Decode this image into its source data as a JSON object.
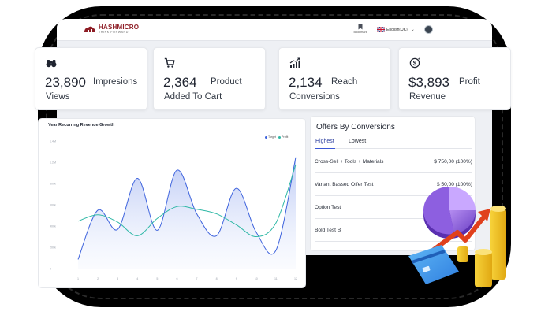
{
  "header": {
    "logo_name": "HASHMICRO",
    "logo_tagline": "THINK FORWARD",
    "bookmark_label": "Bookmark",
    "language_label": "English(UK)"
  },
  "stats": [
    {
      "icon": "binoculars-icon",
      "value": "23,890",
      "unit": "Impresions",
      "sub": "Views"
    },
    {
      "icon": "cart-icon",
      "value": "2,364",
      "unit": "Product",
      "sub": "Added To Cart"
    },
    {
      "icon": "bar-chart-icon",
      "value": "2,134",
      "unit": "Reach",
      "sub": "Conversions"
    },
    {
      "icon": "revenue-icon",
      "value": "$3,893",
      "unit": "Profit",
      "sub": "Revenue"
    }
  ],
  "chart_data": {
    "type": "area",
    "title": "Year Recurring Revenue Growth",
    "x": [
      "1",
      "2",
      "3",
      "4",
      "5",
      "6",
      "7",
      "8",
      "9",
      "10",
      "11",
      "12"
    ],
    "y_ticks": [
      "0",
      "200k",
      "400k",
      "600k",
      "800k",
      "1.2M",
      "1.4M"
    ],
    "ylim": [
      0,
      1400000
    ],
    "series": [
      {
        "name": "Target",
        "color": "#3e63dd",
        "values": [
          100000,
          640000,
          430000,
          990000,
          420000,
          1080000,
          600000,
          360000,
          880000,
          400000,
          200000,
          1220000
        ]
      },
      {
        "name": "Profit",
        "color": "#2fb8a6",
        "values": [
          520000,
          590000,
          510000,
          360000,
          550000,
          680000,
          650000,
          600000,
          480000,
          350000,
          500000,
          1140000
        ]
      }
    ],
    "legend_placement": "top-right",
    "grid": false
  },
  "offers": {
    "title": "Offers By Conversions",
    "tabs": [
      "Highest",
      "Lowest"
    ],
    "active_tab": "Highest",
    "rows": [
      {
        "name": "Cross-Sell + Tools + Materials",
        "value": "$ 750,00 (100%)"
      },
      {
        "name": "Variant Bassed Offer Test",
        "value": "$ 50,00 (100%)"
      },
      {
        "name": "Option Test",
        "value": ""
      },
      {
        "name": "Bold Test B",
        "value": ""
      }
    ]
  },
  "colors": {
    "brand": "#8d1c24",
    "accent": "#3b57d6",
    "teal": "#2fb8a6",
    "background": "#eef0f4"
  }
}
